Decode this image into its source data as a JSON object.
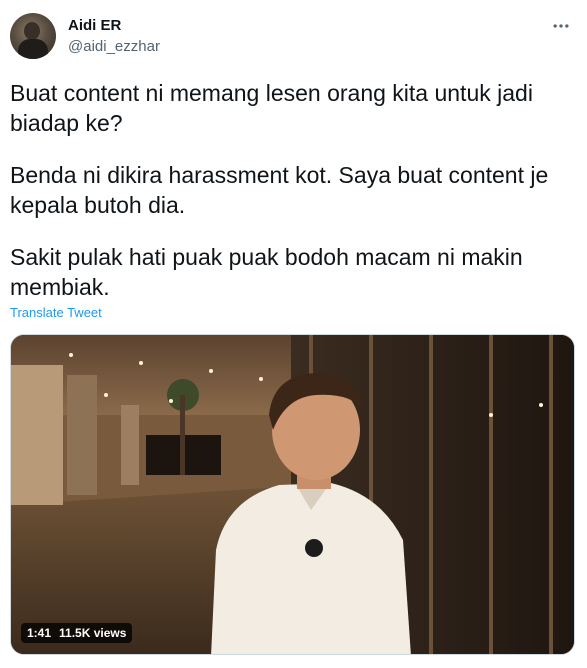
{
  "author": {
    "display_name": "Aidi ER",
    "handle": "@aidi_ezzhar"
  },
  "tweet": {
    "paragraphs": [
      "Buat content ni memang lesen orang kita untuk jadi biadap ke?",
      "Benda ni dikira harassment kot. Saya buat content je kepala butoh dia.",
      "Sakit pulak hati puak puak bodoh macam ni makin membiak."
    ],
    "translate_label": "Translate Tweet"
  },
  "video": {
    "duration": "1:41",
    "views": "11.5K views"
  },
  "icons": {
    "more": "more-horizontal-icon"
  },
  "colors": {
    "text": "#0f1419",
    "secondary": "#536471",
    "link": "#1d9bf0"
  }
}
